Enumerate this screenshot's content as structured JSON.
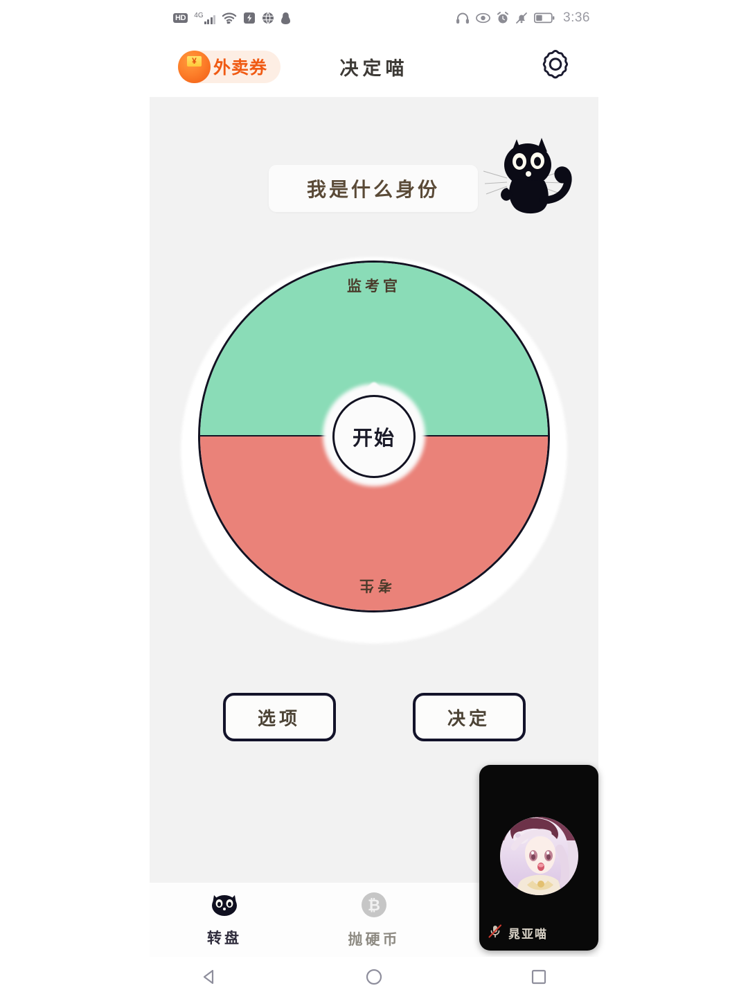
{
  "status_bar": {
    "hd_label": "HD",
    "network_label": "4G",
    "time": "3:36",
    "left_icons": [
      "hd-icon",
      "signal-bars-icon",
      "wifi-icon",
      "screen-record-icon",
      "globe-icon",
      "qq-penguin-icon"
    ],
    "right_icons": [
      "headphone-icon",
      "eye-care-icon",
      "alarm-clock-icon",
      "bell-muted-icon",
      "battery-icon"
    ]
  },
  "header": {
    "coupon_label": "外卖券",
    "coupon_icon": "red-envelope-yen-icon",
    "title": "决定喵",
    "settings_icon": "gear-icon"
  },
  "main": {
    "title_card_text": "我是什么身份",
    "mascot_icon": "black-cat-mascot-icon"
  },
  "wheel": {
    "center_button_label": "开始",
    "segments": [
      {
        "label": "监考官",
        "color": "#8adcb7",
        "position": "top"
      },
      {
        "label": "考生",
        "color": "#ea8279",
        "position": "bottom"
      }
    ],
    "border_color": "#121222"
  },
  "actions": {
    "options_label": "选项",
    "decide_label": "决定"
  },
  "tabbar": {
    "items": [
      {
        "label": "转盘",
        "icon": "cat-face-icon",
        "active": true
      },
      {
        "label": "抛硬币",
        "icon": "bitcoin-coin-icon",
        "active": false
      }
    ]
  },
  "float_video": {
    "name": "晁亚喵",
    "mic_icon": "microphone-muted-icon",
    "avatar_icon": "anime-girl-avatar"
  },
  "navbar": {
    "back_icon": "back-triangle-icon",
    "home_icon": "home-circle-icon",
    "recents_icon": "recents-square-icon"
  },
  "colors": {
    "panel_background": "#f2f2f2",
    "wheel_green": "#8adcb7",
    "wheel_red": "#ea8279",
    "coupon_orange": "#f05a13",
    "coupon_pill_bg": "#fdeee4"
  }
}
